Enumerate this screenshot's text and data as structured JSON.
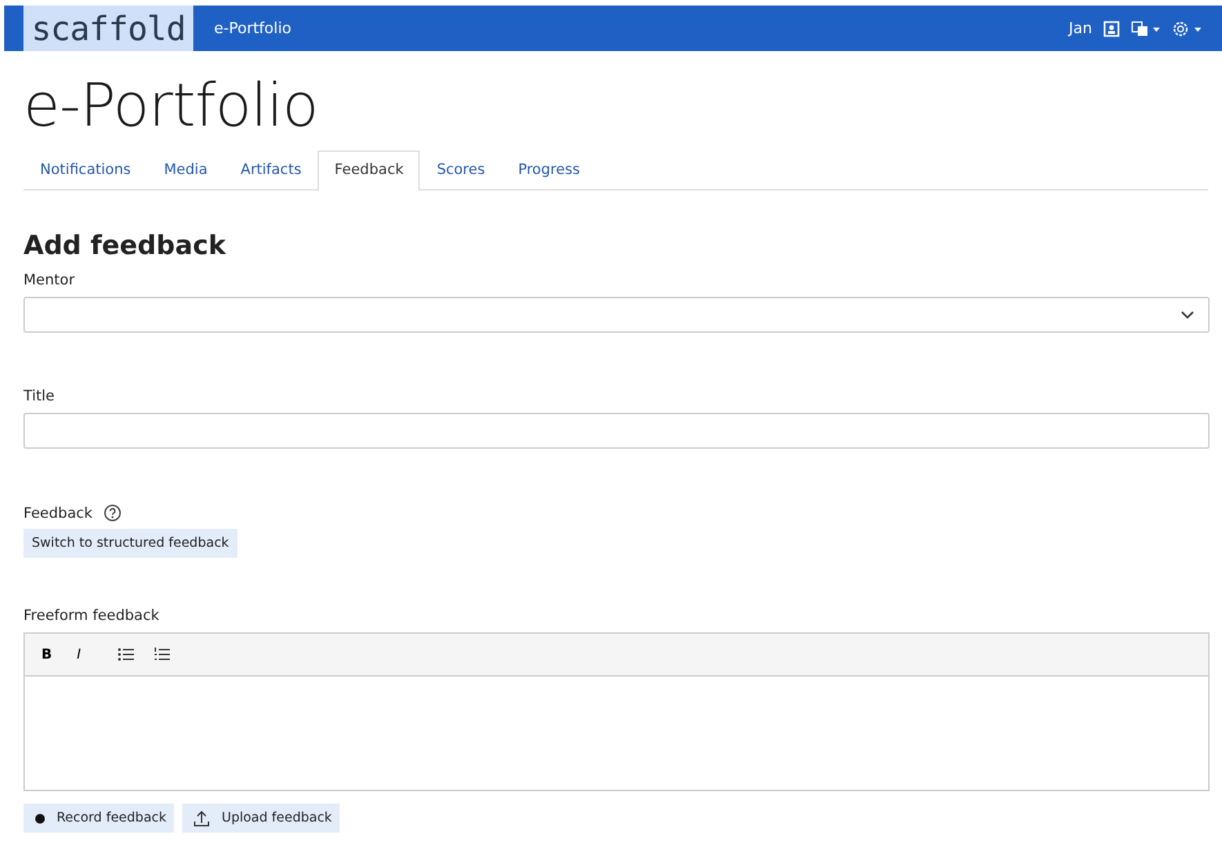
{
  "navbar": {
    "logo": "scaffold",
    "app_title": "e-Portfolio",
    "user": "Jan"
  },
  "page_title": "e-Portfolio",
  "tabs": [
    {
      "label": "Notifications",
      "selected": false
    },
    {
      "label": "Media",
      "selected": false
    },
    {
      "label": "Artifacts",
      "selected": false
    },
    {
      "label": "Feedback",
      "selected": true
    },
    {
      "label": "Scores",
      "selected": false
    },
    {
      "label": "Progress",
      "selected": false
    }
  ],
  "form": {
    "heading": "Add feedback",
    "mentor": {
      "label": "Mentor"
    },
    "title": {
      "label": "Title"
    },
    "feedback": {
      "label": "Feedback",
      "switch_button": "Switch to structured feedback"
    },
    "freeform": {
      "label": "Freeform feedback",
      "toolbar": [
        {
          "kind": "bold",
          "label": "B"
        },
        {
          "kind": "italic",
          "label": "I"
        },
        {
          "kind": "bullets"
        },
        {
          "kind": "numbers"
        }
      ]
    },
    "buttons": [
      {
        "kind": "record",
        "label": "Record feedback"
      },
      {
        "kind": "upload",
        "label": "Upload feedback"
      }
    ]
  }
}
